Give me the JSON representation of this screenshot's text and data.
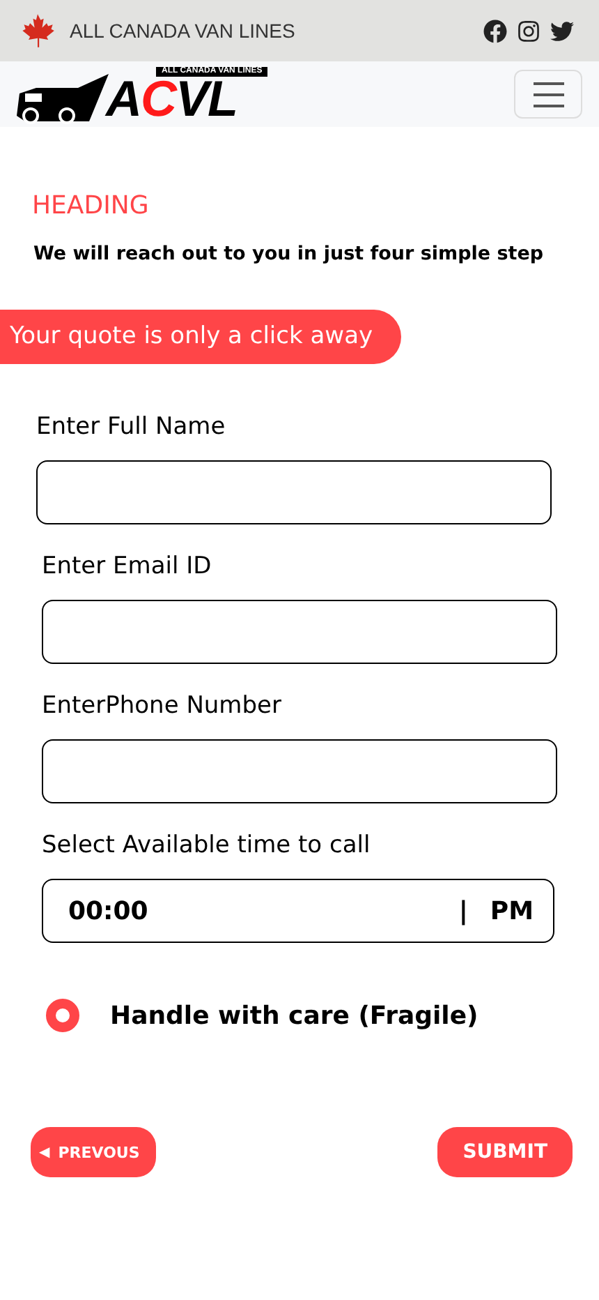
{
  "top_bar": {
    "brand": "ALL CANADA VAN LINES"
  },
  "navbar": {
    "logo": {
      "tagline": "ALL CANADA VAN LINES",
      "letters": [
        {
          "text": "A",
          "color": "#000000"
        },
        {
          "text": "C",
          "color": "#ff1a1a"
        },
        {
          "text": "V",
          "color": "#000000"
        },
        {
          "text": "L",
          "color": "#000000"
        }
      ]
    }
  },
  "heading": "HEADING",
  "subheading": "We will reach out to you in just four simple step",
  "banner": "Your quote is only a click away",
  "fields": [
    {
      "label": "Enter Full Name"
    },
    {
      "label": "Enter Email ID"
    },
    {
      "label": "EnterPhone Number"
    }
  ],
  "time_field": {
    "label": "Select Available time to call",
    "value": "00:00",
    "separator": "|",
    "period": "PM"
  },
  "options": [
    {
      "label": "Handle with care (Fragile)",
      "selected": true
    }
  ],
  "buttons": {
    "previous": {
      "icon": "◀",
      "label": "PREVOUS"
    },
    "submit": "SUBMIT"
  }
}
